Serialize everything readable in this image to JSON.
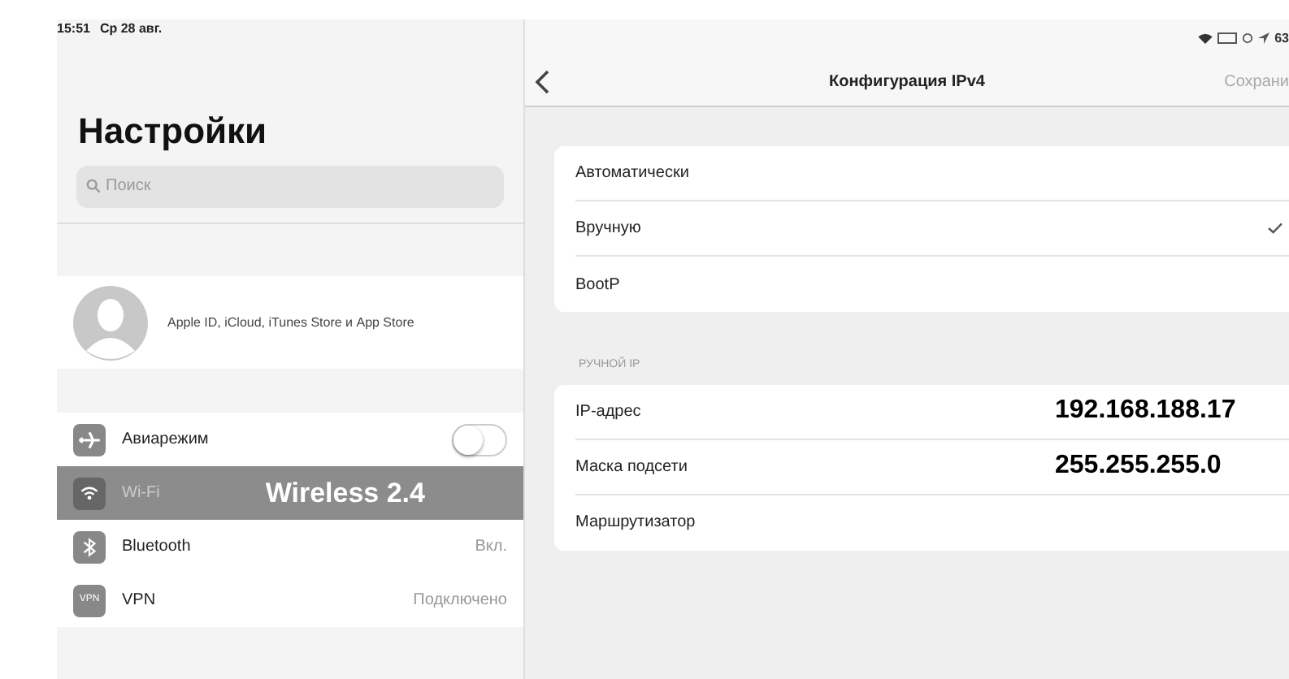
{
  "status_bar": {
    "time": "15:51",
    "date": "Ср 28 авг.",
    "battery": "63"
  },
  "sidebar": {
    "title": "Настройки",
    "search": {
      "placeholder": "Поиск"
    },
    "account": "Apple ID, iCloud, iTunes Store и App Store",
    "items": [
      {
        "kind": "toggle",
        "label": "Авиарежим",
        "on": false,
        "selected": false
      },
      {
        "kind": "value",
        "label": "Wi-Fi",
        "value": "Wireless 2.4",
        "selected": true
      },
      {
        "kind": "value",
        "label": "Bluetooth",
        "value": "Вкл.",
        "selected": false
      },
      {
        "kind": "value",
        "icon_text": "VPN",
        "label": "VPN",
        "value": "Подключено",
        "selected": false
      }
    ]
  },
  "detail": {
    "title": "Конфигурация IPv4",
    "save_button": {
      "label": "Сохрани",
      "disabled": true
    },
    "options": [
      {
        "label": "Автоматически",
        "selected": false
      },
      {
        "label": "Вручную",
        "selected": true
      },
      {
        "label": "BootP",
        "selected": false
      }
    ],
    "manual": {
      "header": "РУЧНОЙ IP",
      "fields": [
        {
          "label": "IP-адрес",
          "value": "192.168.188.17"
        },
        {
          "label": "Маска подсети",
          "value": "255.255.255.0"
        },
        {
          "label": "Маршрутизатор"
        }
      ]
    }
  }
}
